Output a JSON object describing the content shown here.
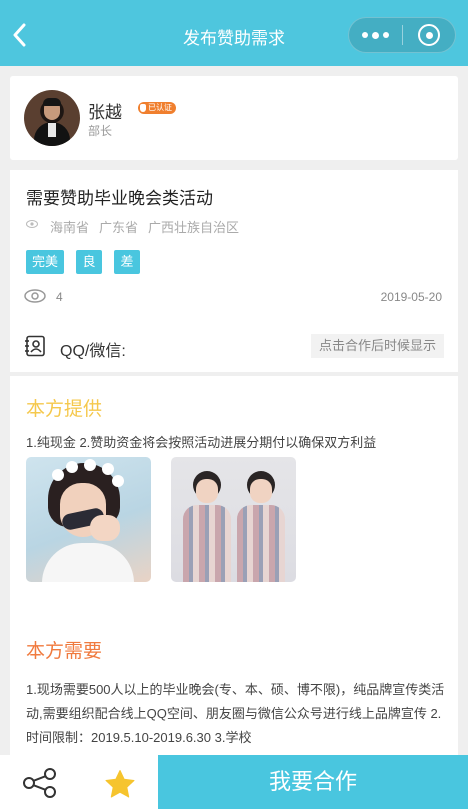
{
  "header": {
    "title": "发布赞助需求",
    "back_icon": "chevron-left-icon",
    "more_icon": "more-dots-icon",
    "close_icon": "target-circle-icon",
    "bg_color": "#4ec6de"
  },
  "user": {
    "name": "张越",
    "badge": "已认证",
    "role": "部长"
  },
  "request": {
    "title": "需要赞助毕业晚会类活动",
    "locations": [
      "海南省",
      "广东省",
      "广西壮族自治区"
    ],
    "tags": [
      "完美",
      "良",
      "差"
    ],
    "views": "4",
    "date": "2019-05-20",
    "contact_label": "QQ/微信:",
    "contact_hint": "点击合作后时候显示"
  },
  "provide": {
    "heading": "本方提供",
    "text": "1.纯现金 2.赞助资金将会按照活动进展分期付以确保双方利益",
    "heading_color": "#f5c84c"
  },
  "need": {
    "heading": "本方需要",
    "text": "1.现场需要500人以上的毕业晚会(专、本、硕、博不限)，纯品牌宣传类活动,需要组织配合线上QQ空间、朋友圈与微信公众号进行线上品牌宣传 2.时间限制：2019.5.10-2019.6.30 3.学校",
    "heading_color": "#f07a3e"
  },
  "bottom": {
    "share_icon": "share-icon",
    "star_icon": "star-icon",
    "cooperate_label": "我要合作",
    "accent": "#49c6df"
  }
}
